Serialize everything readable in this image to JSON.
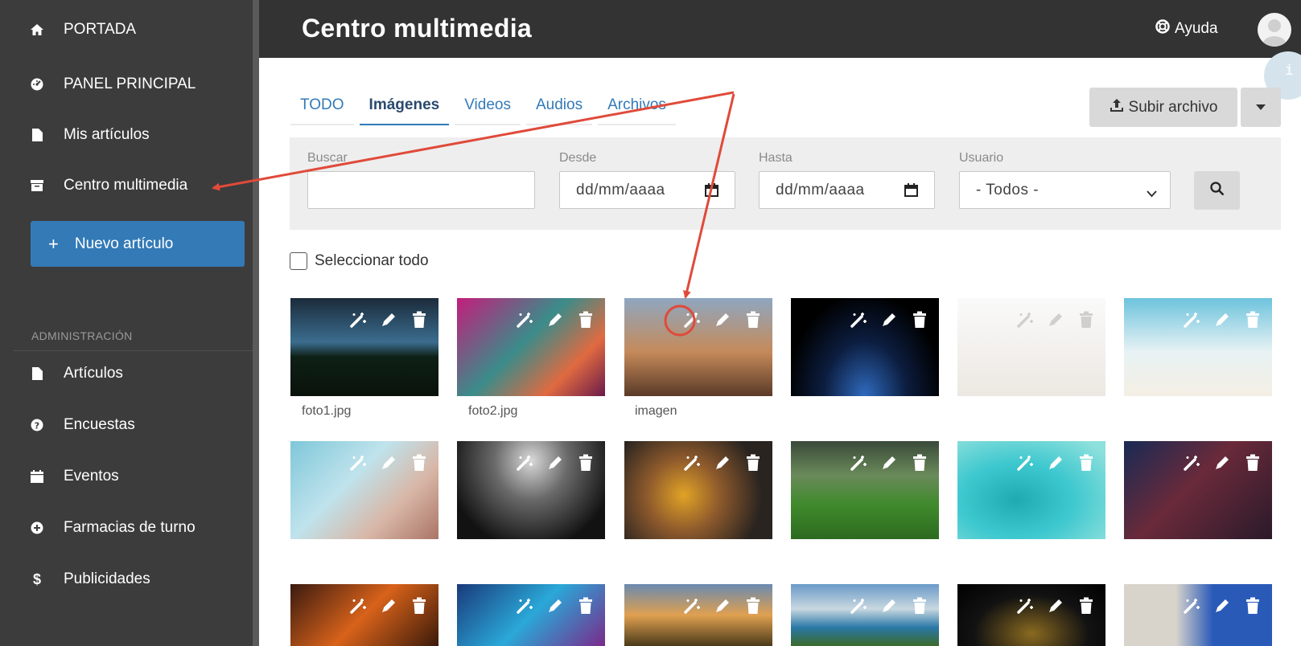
{
  "sidebar": {
    "items": [
      {
        "label": "PORTADA",
        "icon": "home-icon"
      },
      {
        "label": "PANEL PRINCIPAL",
        "icon": "dashboard-icon"
      },
      {
        "label": "Mis artículos",
        "icon": "file-icon"
      },
      {
        "label": "Centro multimedia",
        "icon": "archive-icon"
      }
    ],
    "new_button": "Nuevo artículo",
    "admin_heading": "ADMINISTRACIÓN",
    "admin_items": [
      {
        "label": "Artículos",
        "icon": "file-icon"
      },
      {
        "label": "Encuestas",
        "icon": "question-icon"
      },
      {
        "label": "Eventos",
        "icon": "calendar-icon"
      },
      {
        "label": "Farmacias de turno",
        "icon": "plus-circle-icon"
      },
      {
        "label": "Publicidades",
        "icon": "dollar-icon"
      }
    ]
  },
  "header": {
    "title": "Centro multimedia",
    "help": "Ayuda"
  },
  "tabs": [
    {
      "label": "TODO",
      "active": false
    },
    {
      "label": "Imágenes",
      "active": true
    },
    {
      "label": "Videos",
      "active": false
    },
    {
      "label": "Audios",
      "active": false
    },
    {
      "label": "Archivos",
      "active": false
    }
  ],
  "upload": {
    "label": "Subir archivo"
  },
  "filters": {
    "search_label": "Buscar",
    "from_label": "Desde",
    "from_value": "dd/mm/aaaa",
    "to_label": "Hasta",
    "to_value": "dd/mm/aaaa",
    "user_label": "Usuario",
    "user_value": "- Todos -"
  },
  "select_all": "Seleccionar todo",
  "captions": [
    "foto1.jpg",
    "foto2.jpg",
    "imagen"
  ],
  "colors": {
    "sidebar": "#3c3c3c",
    "topbar": "#333333",
    "accent": "#337ab7",
    "annotation": "#e04a3a"
  }
}
